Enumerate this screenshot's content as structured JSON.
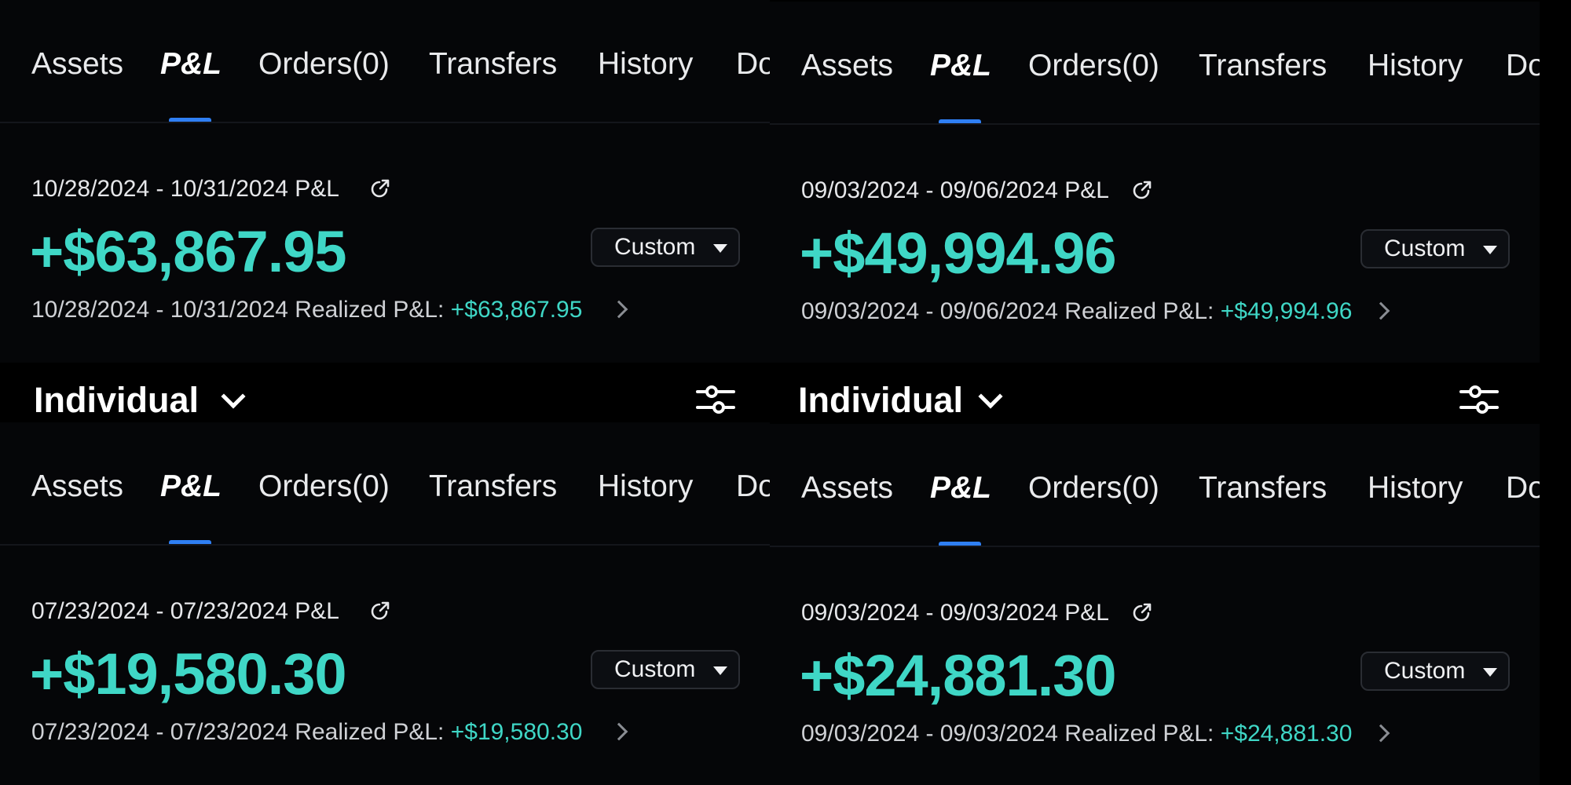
{
  "tabs": [
    "Assets",
    "P&L",
    "Orders(0)",
    "Transfers",
    "History",
    "Do"
  ],
  "custom_label": "Custom",
  "account": {
    "label": "Individual"
  },
  "panels": [
    {
      "period": "10/28/2024 - 10/31/2024 P&L",
      "amount": "+$63,867.95",
      "realized_label": "10/28/2024 - 10/31/2024 Realized P&L: ",
      "realized_value": "+$63,867.95"
    },
    {
      "period": "09/03/2024 - 09/06/2024 P&L",
      "amount": "+$49,994.96",
      "realized_label": "09/03/2024 - 09/06/2024 Realized P&L: ",
      "realized_value": "+$49,994.96"
    },
    {
      "period": "07/23/2024 - 07/23/2024 P&L",
      "amount": "+$19,580.30",
      "realized_label": "07/23/2024 - 07/23/2024 Realized P&L: ",
      "realized_value": "+$19,580.30"
    },
    {
      "period": "09/03/2024 - 09/03/2024 P&L",
      "amount": "+$24,881.30",
      "realized_label": "09/03/2024 - 09/03/2024 Realized P&L: ",
      "realized_value": "+$24,881.30"
    }
  ],
  "colors": {
    "profit": "#3fd7c6",
    "tab_indicator": "#2f7ff3",
    "background": "#000000"
  },
  "icons": [
    "share-icon",
    "chevron-down-icon",
    "chevron-right-icon",
    "filter-sliders-icon",
    "dropdown-caret-icon"
  ]
}
